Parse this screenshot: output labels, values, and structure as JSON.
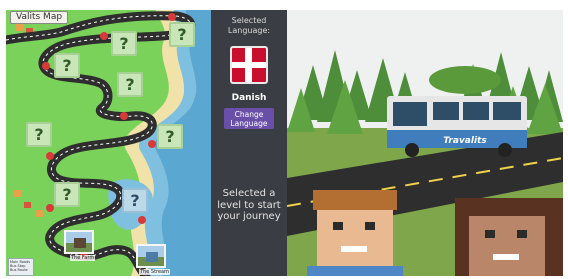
{
  "map": {
    "title": "Valits Map",
    "level_tile_symbol": "?",
    "photo_levels": [
      {
        "caption": "The Farm"
      },
      {
        "caption": "The Stream"
      }
    ],
    "legend_lines": [
      "Main Roads",
      "Bus Stop",
      "Bus Route"
    ]
  },
  "language_panel": {
    "heading": "Selected Language:",
    "language_name": "Danish",
    "flag_icon": "danish-flag-icon",
    "change_button_label": "Change Language",
    "prompt": "Selected a level to start your journey"
  },
  "scene": {
    "bus_label": "Travalits"
  },
  "colors": {
    "panel_bg": "#3b3d44",
    "button_purple": "#6a4fa8",
    "flag_red": "#c8102e",
    "grass": "#7bd25a",
    "road": "#2e2e2e"
  }
}
